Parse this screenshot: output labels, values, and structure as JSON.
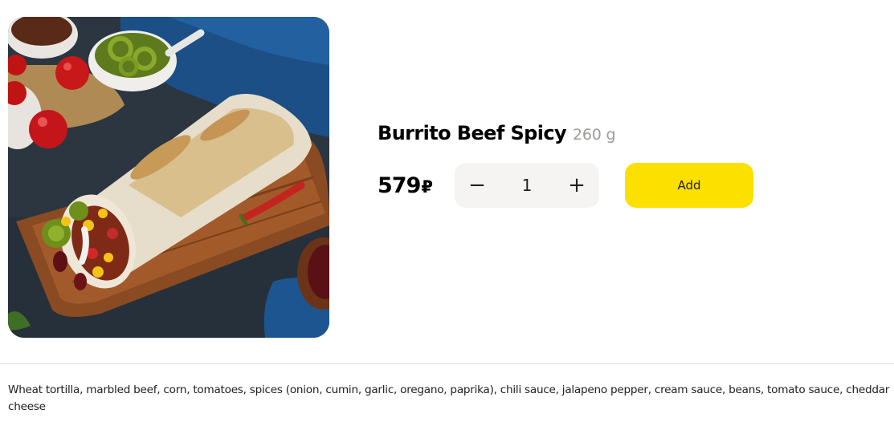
{
  "product": {
    "name": "Burrito Beef Spicy",
    "weight": "260 g",
    "price": "579",
    "currency": "₽",
    "quantity": "1",
    "decrement_label": "−",
    "increment_label": "+",
    "add_label": "Add",
    "description": "Wheat tortilla, marbled beef, corn, tomatoes, spices (onion, cumin, garlic, oregano, paprika), chili sauce, jalapeno pepper, cream sauce, beans, tomato sauce, cheddar cheese"
  },
  "colors": {
    "accent": "#fce000",
    "stepper_bg": "#f5f4f2",
    "muted_text": "#9e9b98"
  }
}
